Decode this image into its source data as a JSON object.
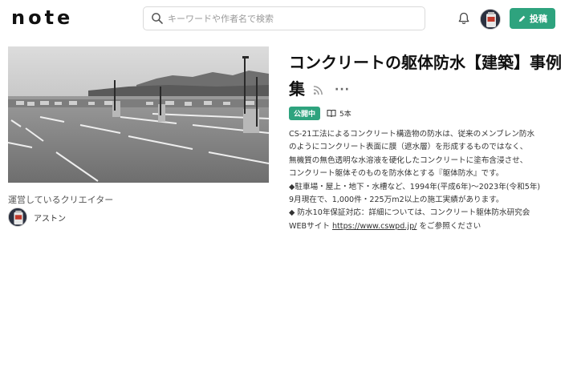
{
  "header": {
    "logo": "note",
    "search_placeholder": "キーワードや作者名で検索",
    "post_label": "投稿"
  },
  "magazine": {
    "title": "コンクリートの躯体防水【建築】事例集",
    "status_badge": "公開中",
    "article_count": "5本",
    "description_lines": [
      "CS-21工法によるコンクリート構造物の防水は、従来のメンブレン防水",
      "のようにコンクリート表面に膜（遮水層）を形成するものではなく、",
      "無機質の無色透明な水溶液を硬化したコンクリートに塗布含浸させ、",
      "コンクリート躯体そのものを防水体とする『躯体防水』です。",
      "◆駐車場・屋上・地下・水槽など、1994年(平成6年)～2023年(令和5年)",
      "9月現在で、1,000件・225万m2以上の施工実績があります。",
      "◆ 防水10年保証対応：詳細については、コンクリート躯体防水研究会"
    ],
    "last_line_prefix": "WEBサイト ",
    "link_text": "https://www.cswpd.jp/",
    "last_line_suffix": " をご参照ください"
  },
  "creators": {
    "label": "運営しているクリエイター",
    "items": [
      {
        "name": "アストン"
      }
    ]
  },
  "colors": {
    "accent": "#2ea37e"
  },
  "icons": [
    "search-icon",
    "bell-icon",
    "pencil-icon",
    "rss-icon",
    "more-icon",
    "book-icon"
  ]
}
